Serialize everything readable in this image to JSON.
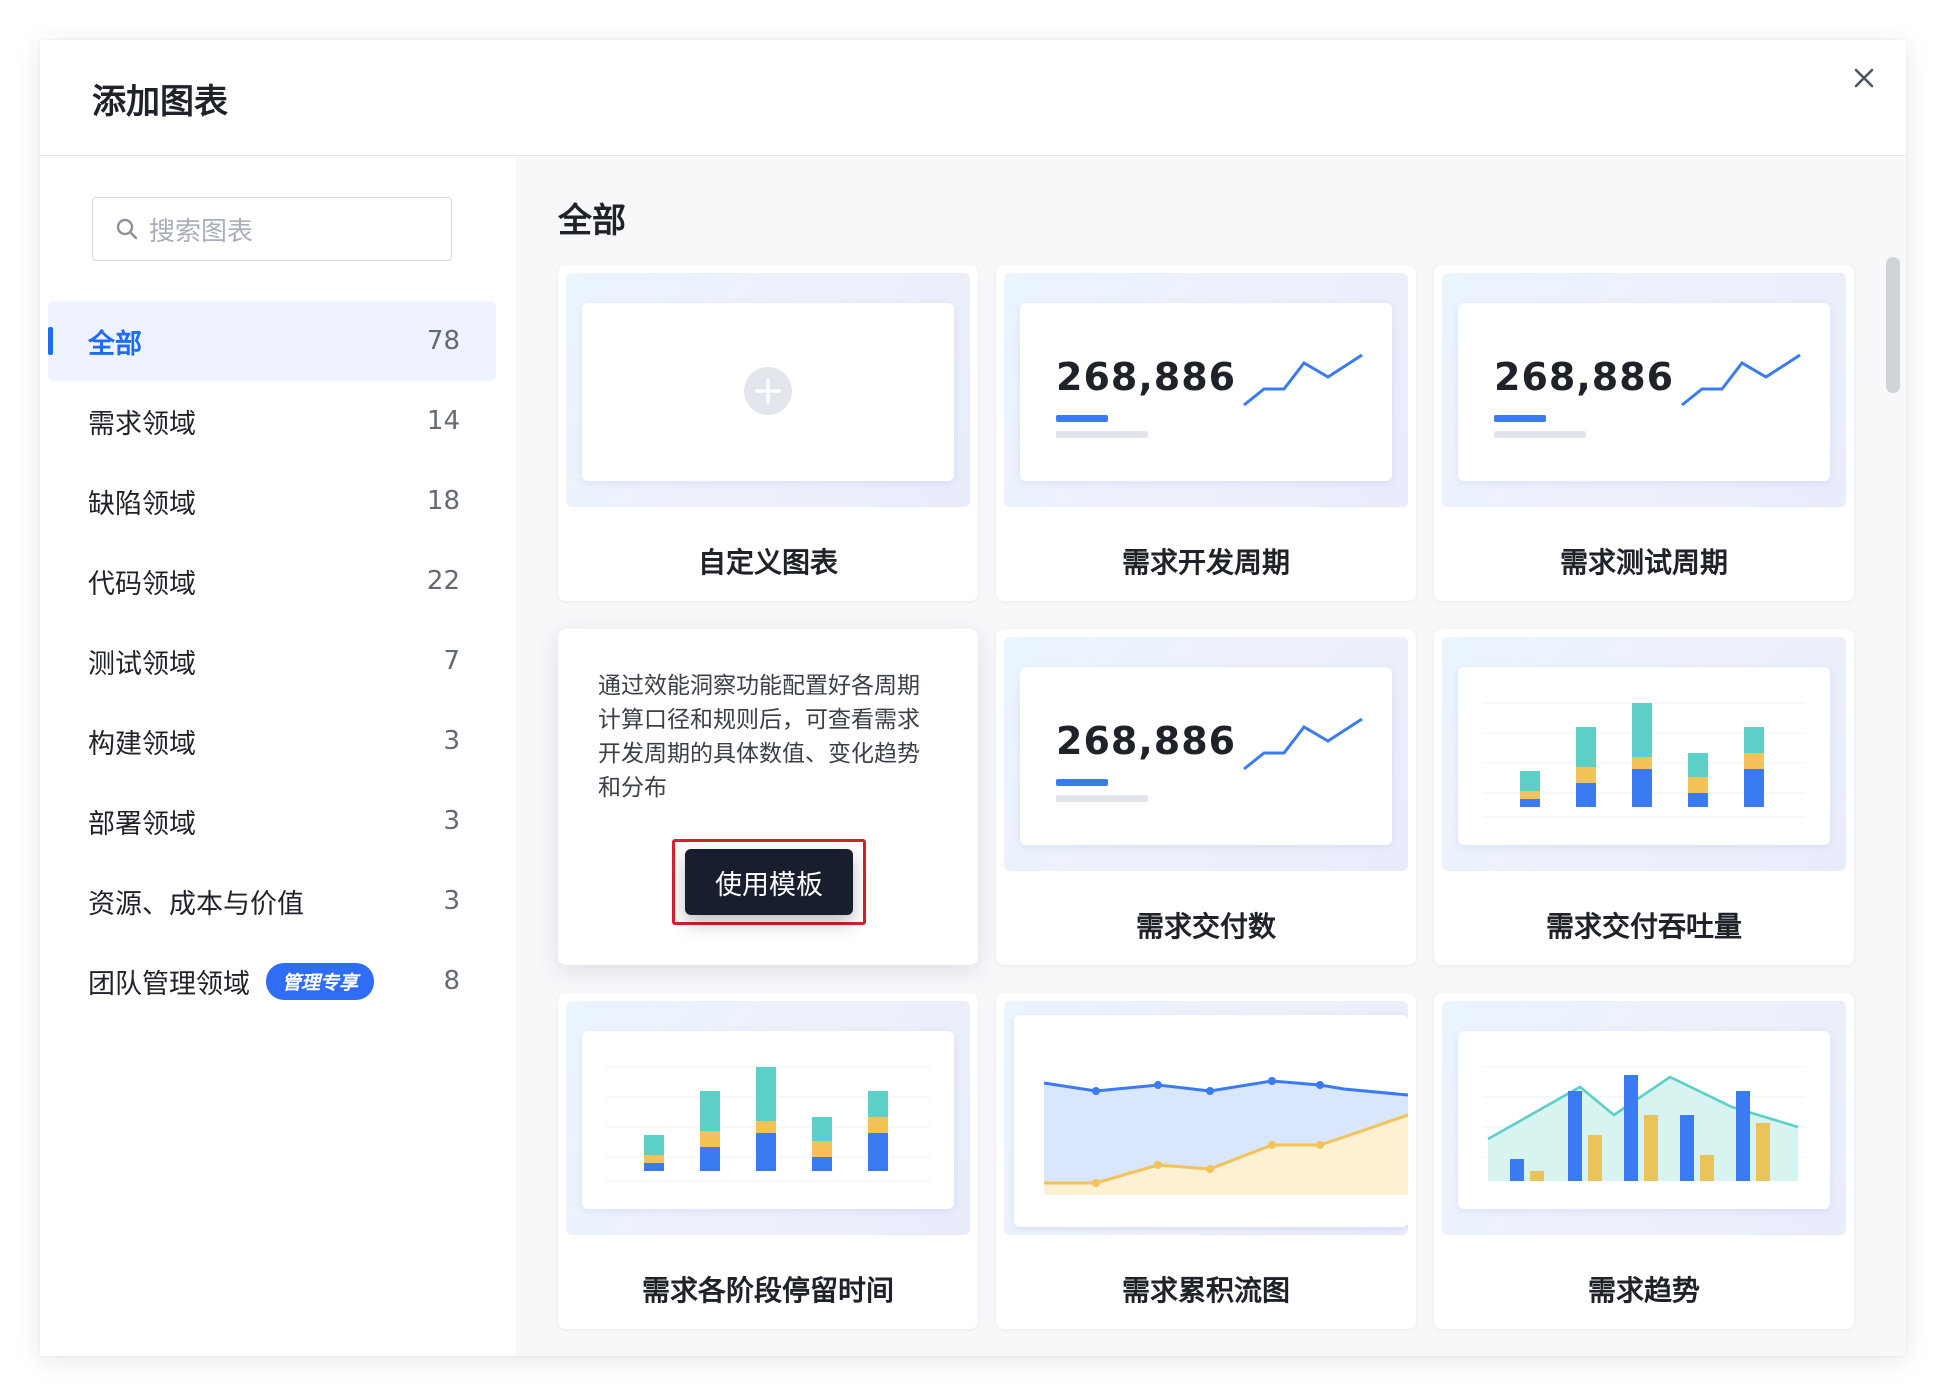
{
  "modal": {
    "title": "添加图表",
    "close_icon": "close-icon"
  },
  "search": {
    "placeholder": "搜索图表",
    "icon": "search-icon"
  },
  "categories": [
    {
      "label": "全部",
      "count": "78",
      "active": true
    },
    {
      "label": "需求领域",
      "count": "14"
    },
    {
      "label": "缺陷领域",
      "count": "18"
    },
    {
      "label": "代码领域",
      "count": "22"
    },
    {
      "label": "测试领域",
      "count": "7"
    },
    {
      "label": "构建领域",
      "count": "3"
    },
    {
      "label": "部署领域",
      "count": "3"
    },
    {
      "label": "资源、成本与价值",
      "count": "3"
    },
    {
      "label": "团队管理领域",
      "count": "8",
      "badge": "管理专享"
    }
  ],
  "section": {
    "title": "全部"
  },
  "cards": [
    {
      "title": "自定义图表",
      "preview": "plus"
    },
    {
      "title": "需求开发周期",
      "preview": "metric",
      "value": "268,886"
    },
    {
      "title": "需求测试周期",
      "preview": "metric",
      "value": "268,886"
    },
    {
      "title": "",
      "preview": "description",
      "description": "通过效能洞察功能配置好各周期计算口径和规则后，可查看需求开发周期的具体数值、变化趋势和分布",
      "button": "使用模板"
    },
    {
      "title": "需求交付数",
      "preview": "metric",
      "value": "268,886"
    },
    {
      "title": "需求交付吞吐量",
      "preview": "stacked-bar"
    },
    {
      "title": "需求各阶段停留时间",
      "preview": "stacked-bar"
    },
    {
      "title": "需求累积流图",
      "preview": "area"
    },
    {
      "title": "需求趋势",
      "preview": "bar-line"
    }
  ],
  "colors": {
    "accent": "#1f6cf0",
    "badge": "#2f6df6",
    "teal": "#5ccfc6",
    "yellow": "#f3c35a",
    "blue": "#3a7bf2",
    "button_dark": "#171e2e",
    "highlight_red": "#d4212d"
  }
}
